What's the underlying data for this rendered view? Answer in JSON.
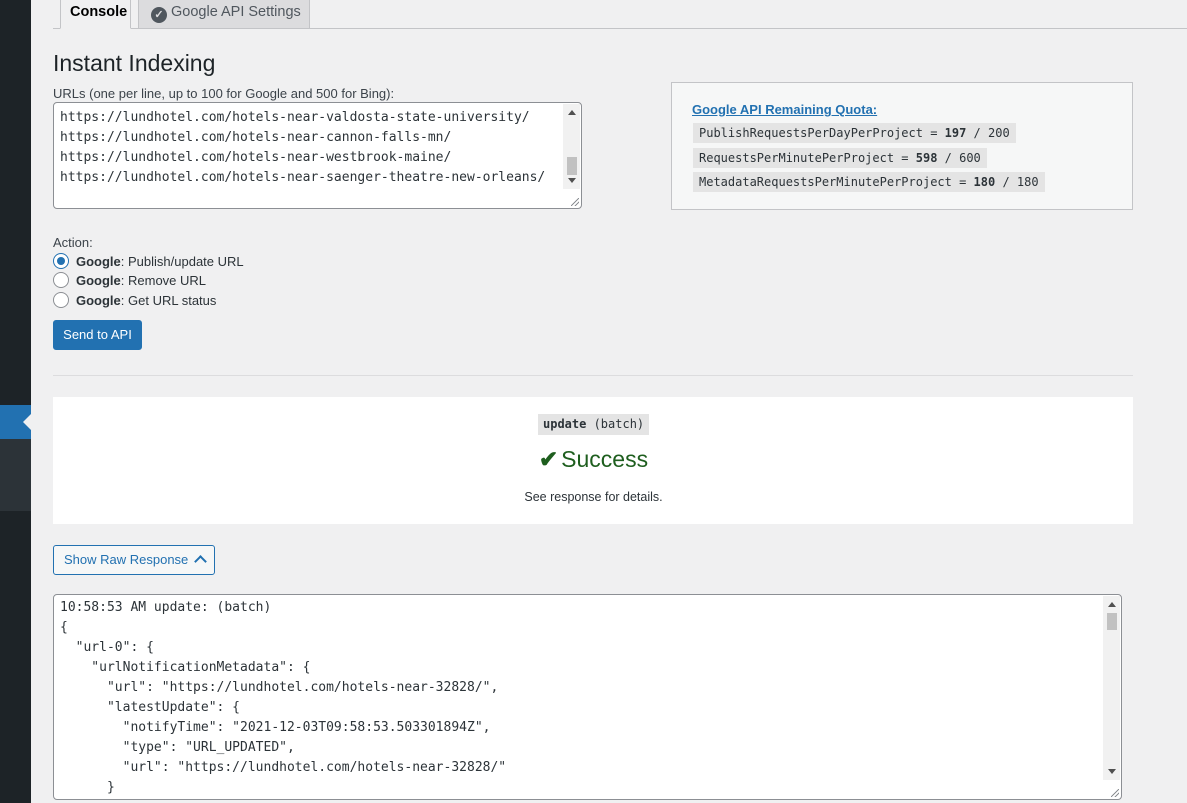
{
  "tabs": {
    "console": "Console",
    "google_api_settings": "Google API Settings"
  },
  "page_title": "Instant Indexing",
  "urls_label": "URLs (one per line, up to 100 for Google and 500 for Bing):",
  "urls_lines": [
    "https://lundhotel.com/hotels-near-valdosta-state-university/",
    "https://lundhotel.com/hotels-near-cannon-falls-mn/",
    "https://lundhotel.com/hotels-near-westbrook-maine/",
    "https://lundhotel.com/hotels-near-saenger-theatre-new-orleans/"
  ],
  "quota": {
    "title": "Google API Remaining Quota:",
    "rows": [
      {
        "name": "PublishRequestsPerDayPerProject = ",
        "remaining": "197",
        "limit": " / 200"
      },
      {
        "name": "RequestsPerMinutePerProject = ",
        "remaining": "598",
        "limit": " / 600"
      },
      {
        "name": "MetadataRequestsPerMinutePerProject = ",
        "remaining": "180",
        "limit": " / 180"
      }
    ]
  },
  "action": {
    "label": "Action:",
    "options": [
      {
        "prefix": "Google",
        "text": ": Publish/update URL",
        "checked": true
      },
      {
        "prefix": "Google",
        "text": ": Remove URL",
        "checked": false
      },
      {
        "prefix": "Google",
        "text": ": Get URL status",
        "checked": false
      }
    ]
  },
  "send_button": "Send to API",
  "result": {
    "badge_bold": "update",
    "badge_rest": " (batch)",
    "status": "Success",
    "details": "See response for details."
  },
  "raw_button": "Show Raw Response",
  "raw_lines": [
    "10:58:53 AM update: (batch)",
    "{",
    "  \"url-0\": {",
    "    \"urlNotificationMetadata\": {",
    "      \"url\": \"https://lundhotel.com/hotels-near-32828/\",",
    "      \"latestUpdate\": {",
    "        \"notifyTime\": \"2021-12-03T09:58:53.503301894Z\",",
    "        \"type\": \"URL_UPDATED\",",
    "        \"url\": \"https://lundhotel.com/hotels-near-32828/\"",
    "      }"
  ],
  "icons": {
    "tab_check": "check-circle-icon",
    "success": "checkmark-icon",
    "raw_toggle": "chevron-up-icon",
    "menu_pointer": "menu-pointer-icon"
  },
  "colors": {
    "accent": "#2271b1",
    "success": "#1e5e1e",
    "sidebar": "#1d2327"
  }
}
